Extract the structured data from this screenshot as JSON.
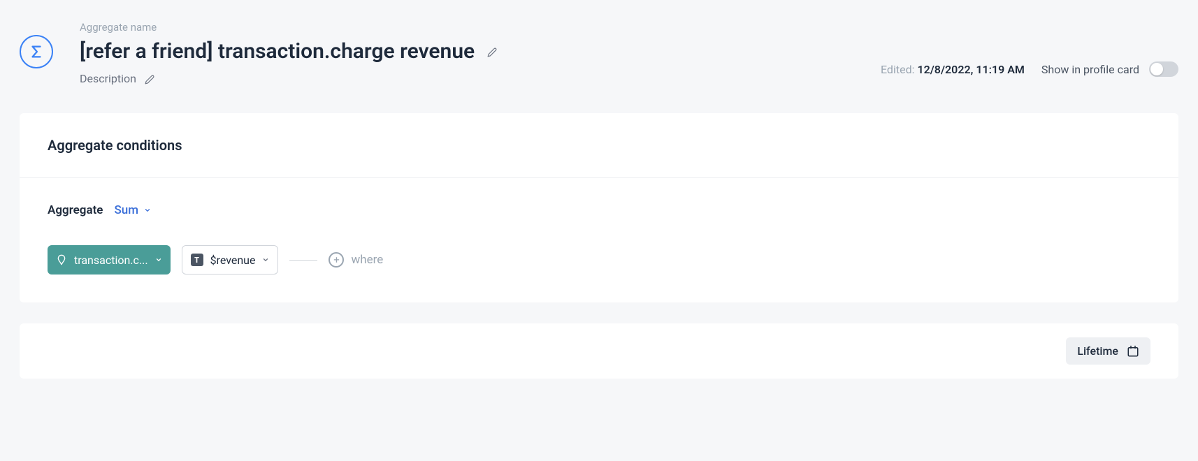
{
  "header": {
    "name_label": "Aggregate name",
    "title": "[refer a friend] transaction.charge revenue",
    "description_label": "Description",
    "edited_label": "Edited: ",
    "edited_value": "12/8/2022, 11:19 AM",
    "profile_card_label": "Show in profile card"
  },
  "conditions": {
    "heading": "Aggregate conditions",
    "aggregate_label": "Aggregate",
    "aggregate_function": "Sum",
    "event": "transaction.c...",
    "property": "$revenue",
    "type_badge": "T",
    "where_label": "where"
  },
  "footer": {
    "timeframe": "Lifetime"
  }
}
